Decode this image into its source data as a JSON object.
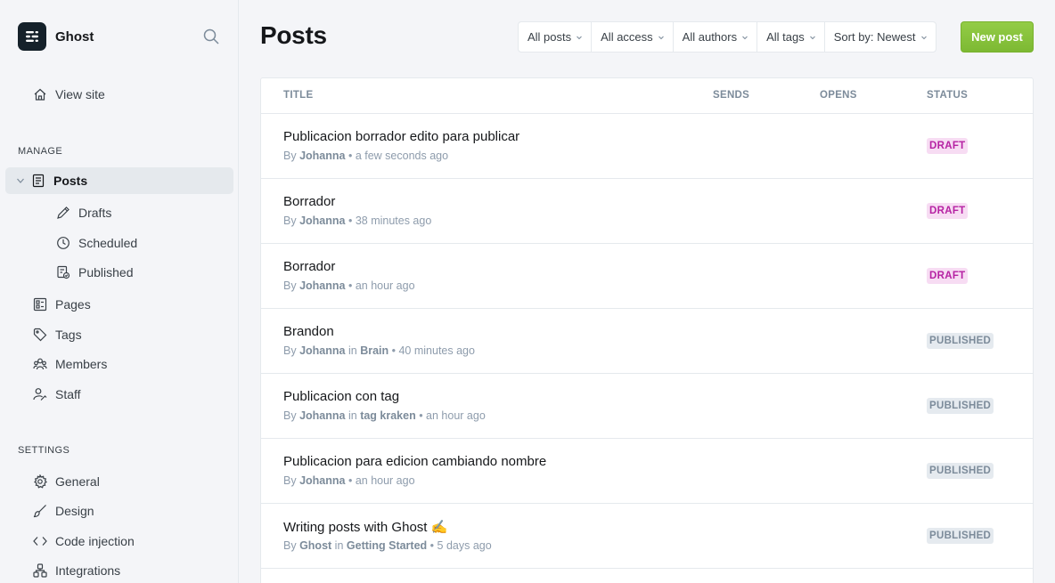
{
  "app": {
    "name": "Ghost"
  },
  "sidebar": {
    "view_site": "View site",
    "manage_title": "MANAGE",
    "posts": "Posts",
    "drafts": "Drafts",
    "scheduled": "Scheduled",
    "published": "Published",
    "pages": "Pages",
    "tags": "Tags",
    "members": "Members",
    "staff": "Staff",
    "settings_title": "SETTINGS",
    "general": "General",
    "design": "Design",
    "code_injection": "Code injection",
    "integrations": "Integrations"
  },
  "header": {
    "title": "Posts",
    "filters": [
      "All posts",
      "All access",
      "All authors",
      "All tags",
      "Sort by: Newest"
    ],
    "new_post": "New post"
  },
  "table": {
    "columns": [
      "TITLE",
      "SENDS",
      "OPENS",
      "STATUS"
    ],
    "rows": [
      {
        "title": "Publicacion borrador edito para publicar",
        "by": "By",
        "author": "Johanna",
        "in": "",
        "tag": "",
        "time": "a few seconds ago",
        "status": "DRAFT"
      },
      {
        "title": "Borrador",
        "by": "By",
        "author": "Johanna",
        "in": "",
        "tag": "",
        "time": "38 minutes ago",
        "status": "DRAFT"
      },
      {
        "title": "Borrador",
        "by": "By",
        "author": "Johanna",
        "in": "",
        "tag": "",
        "time": "an hour ago",
        "status": "DRAFT"
      },
      {
        "title": "Brandon",
        "by": "By",
        "author": "Johanna",
        "in": "in",
        "tag": "Brain",
        "time": "40 minutes ago",
        "status": "PUBLISHED"
      },
      {
        "title": "Publicacion con tag",
        "by": "By",
        "author": "Johanna",
        "in": "in",
        "tag": "tag kraken",
        "time": "an hour ago",
        "status": "PUBLISHED"
      },
      {
        "title": "Publicacion para edicion cambiando nombre",
        "by": "By",
        "author": "Johanna",
        "in": "",
        "tag": "",
        "time": "an hour ago",
        "status": "PUBLISHED"
      },
      {
        "title": "Writing posts with Ghost ✍️",
        "by": "By",
        "author": "Ghost",
        "in": "in",
        "tag": "Getting Started",
        "time": "5 days ago",
        "status": "PUBLISHED"
      }
    ]
  },
  "colors": {
    "accent": "#8cc63f",
    "draft": "#b622a3",
    "published": "#7c8b9a"
  }
}
